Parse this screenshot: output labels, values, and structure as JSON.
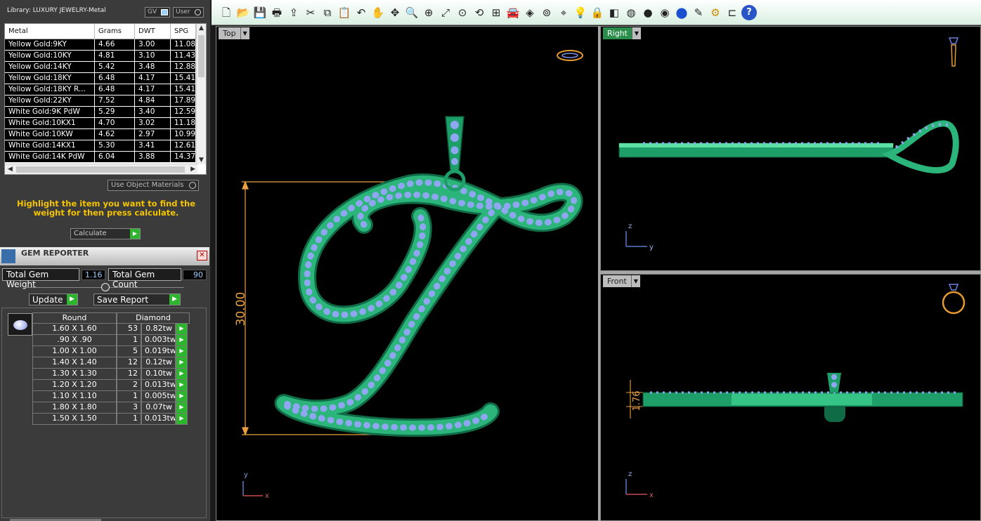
{
  "library": {
    "title": "Library: LUXURY JEWELRY-Metal",
    "gv_label": "GV",
    "user_label": "User",
    "columns": [
      "Metal",
      "Grams",
      "DWT",
      "SPG"
    ],
    "rows": [
      {
        "metal": "Yellow Gold:9KY",
        "grams": "4.66",
        "dwt": "3.00",
        "spg": "11.08"
      },
      {
        "metal": "Yellow Gold:10KY",
        "grams": "4.81",
        "dwt": "3.10",
        "spg": "11.43"
      },
      {
        "metal": "Yellow Gold:14KY",
        "grams": "5.42",
        "dwt": "3.48",
        "spg": "12.88"
      },
      {
        "metal": "Yellow Gold:18KY",
        "grams": "6.48",
        "dwt": "4.17",
        "spg": "15.41"
      },
      {
        "metal": "Yellow Gold:18KY R...",
        "grams": "6.48",
        "dwt": "4.17",
        "spg": "15.41"
      },
      {
        "metal": "Yellow Gold:22KY",
        "grams": "7.52",
        "dwt": "4.84",
        "spg": "17.89"
      },
      {
        "metal": "White Gold:9K PdW",
        "grams": "5.29",
        "dwt": "3.40",
        "spg": "12.59"
      },
      {
        "metal": "White Gold:10KX1",
        "grams": "4.70",
        "dwt": "3.02",
        "spg": "11.18"
      },
      {
        "metal": "White Gold:10KW",
        "grams": "4.62",
        "dwt": "2.97",
        "spg": "10.99"
      },
      {
        "metal": "White Gold:14KX1",
        "grams": "5.30",
        "dwt": "3.41",
        "spg": "12.61"
      },
      {
        "metal": "White Gold:14K PdW",
        "grams": "6.04",
        "dwt": "3.88",
        "spg": "14.37"
      }
    ],
    "use_object_materials": "Use Object Materials",
    "hint": "Highlight the item you want to find the weight for then press calculate.",
    "calculate_label": "Calculate"
  },
  "gem_reporter": {
    "title": "GEM REPORTER",
    "total_weight_label": "Total Gem Weight",
    "total_weight_value": "1.16",
    "total_count_label": "Total Gem Count",
    "total_count_value": "90",
    "update_label": "Update",
    "save_report_label": "Save Report",
    "shape": "Round",
    "material": "Diamond",
    "rows": [
      {
        "size": "1.60 X 1.60",
        "count": "53",
        "weight": "0.82tw"
      },
      {
        "size": ".90 X .90",
        "count": "1",
        "weight": "0.003tw"
      },
      {
        "size": "1.00 X 1.00",
        "count": "5",
        "weight": "0.019tw"
      },
      {
        "size": "1.40 X 1.40",
        "count": "12",
        "weight": "0.12tw"
      },
      {
        "size": "1.30 X 1.30",
        "count": "12",
        "weight": "0.10tw"
      },
      {
        "size": "1.20 X 1.20",
        "count": "2",
        "weight": "0.013tw"
      },
      {
        "size": "1.10 X 1.10",
        "count": "1",
        "weight": "0.005tw"
      },
      {
        "size": "1.80 X 1.80",
        "count": "3",
        "weight": "0.07tw"
      },
      {
        "size": "1.50 X 1.50",
        "count": "1",
        "weight": "0.013tw"
      }
    ]
  },
  "toolbar": {
    "icons": [
      "new-file-icon",
      "open-folder-icon",
      "save-icon",
      "print-icon",
      "export-icon",
      "cut-icon",
      "copy-icon",
      "paste-icon",
      "undo-icon",
      "pan-hand-icon",
      "move-icon",
      "zoom-icon",
      "zoom-window-icon",
      "zoom-extents-icon",
      "zoom-selected-icon",
      "rotate-view-icon",
      "four-viewports-icon",
      "car-icon",
      "camera-icon",
      "snap-icon",
      "gumball-icon",
      "light-icon",
      "lock-icon",
      "layers-icon",
      "color-wheel-icon",
      "shaded-sphere-icon",
      "render-sphere-icon",
      "blue-sphere-icon",
      "highlight-icon",
      "settings-gear-icon",
      "tree-icon",
      "help-icon"
    ]
  },
  "viewports": {
    "top": {
      "label": "Top",
      "dimension": "30.00",
      "axis_x": "x",
      "axis_y": "y"
    },
    "right": {
      "label": "Right",
      "axis_h": "y",
      "axis_v": "z"
    },
    "front": {
      "label": "Front",
      "dimension": "1.76",
      "axis_h": "x",
      "axis_v": "z"
    }
  },
  "colors": {
    "metal": "#1e9e68",
    "gem": "#8fa6f0",
    "dimension": "#e8a040",
    "accent_green": "#2db52d",
    "hint_text": "#f5c400"
  }
}
